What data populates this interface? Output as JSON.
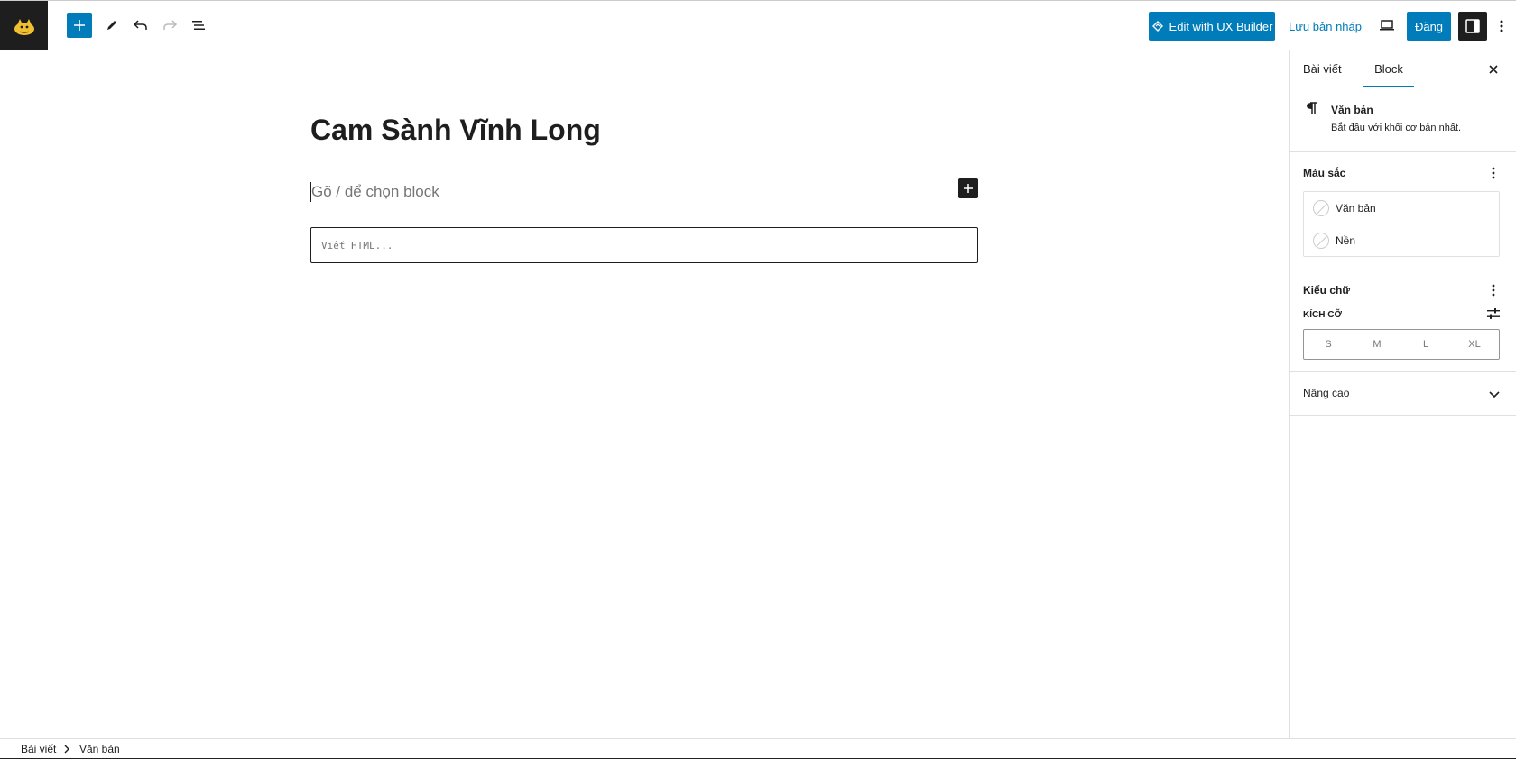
{
  "header": {
    "logo_icon": "cat-logo-icon",
    "add_block_icon": "plus-icon",
    "tools_icon": "pencil-icon",
    "undo_icon": "undo-icon",
    "redo_icon": "redo-icon",
    "list_view_icon": "list-view-icon",
    "ux_builder_label": "Edit with UX Builder",
    "save_draft_label": "Lưu bản nháp",
    "preview_icon": "desktop-preview-icon",
    "publish_label": "Đăng",
    "settings_icon": "sidebar-toggle-icon",
    "options_icon": "more-vertical-icon",
    "accent_color": "#007cba"
  },
  "editor": {
    "title": "Cam Sành Vĩnh Long",
    "paragraph_placeholder": "Gõ / để chọn block",
    "html_placeholder": "Viết HTML..."
  },
  "sidebar": {
    "tabs": [
      "Bài viết",
      "Block"
    ],
    "active_tab": "Block",
    "block_card": {
      "icon": "paragraph-icon",
      "title": "Văn bản",
      "description": "Bắt đầu với khối cơ bản nhất."
    },
    "color_panel": {
      "title": "Màu sắc",
      "items": [
        "Văn bản",
        "Nền"
      ]
    },
    "typography_panel": {
      "title": "Kiểu chữ",
      "size_label": "KÍCH CỠ",
      "sizes": [
        "S",
        "M",
        "L",
        "XL"
      ]
    },
    "advanced_label": "Nâng cao"
  },
  "footer": {
    "breadcrumb": [
      "Bài viết",
      "Văn bản"
    ]
  }
}
